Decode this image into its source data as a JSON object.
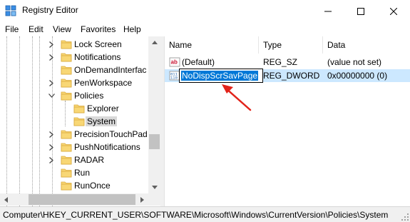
{
  "window": {
    "title": "Registry Editor"
  },
  "menu": [
    "File",
    "Edit",
    "View",
    "Favorites",
    "Help"
  ],
  "tree": {
    "items": [
      {
        "label": "Lock Screen",
        "expander": "collapsed",
        "level": 0
      },
      {
        "label": "Notifications",
        "expander": "collapsed",
        "level": 0
      },
      {
        "label": "OnDemandInterfac",
        "expander": "none",
        "level": 0
      },
      {
        "label": "PenWorkspace",
        "expander": "collapsed",
        "level": 0
      },
      {
        "label": "Policies",
        "expander": "expanded",
        "level": 0
      },
      {
        "label": "Explorer",
        "expander": "none",
        "level": 1
      },
      {
        "label": "System",
        "expander": "none",
        "level": 1,
        "selected": true
      },
      {
        "label": "PrecisionTouchPad",
        "expander": "collapsed",
        "level": 0
      },
      {
        "label": "PushNotifications",
        "expander": "collapsed",
        "level": 0
      },
      {
        "label": "RADAR",
        "expander": "collapsed",
        "level": 0
      },
      {
        "label": "Run",
        "expander": "none",
        "level": 0
      },
      {
        "label": "RunOnce",
        "expander": "none",
        "level": 0
      }
    ]
  },
  "list": {
    "columns": [
      "Name",
      "Type",
      "Data"
    ],
    "rows": [
      {
        "icon": "string-value-icon",
        "name": "(Default)",
        "type": "REG_SZ",
        "data": "(value not set)"
      },
      {
        "icon": "binary-value-icon",
        "name": "NoDispScrSavPage",
        "type": "REG_DWORD",
        "data": "0x00000000 (0)",
        "editing": true,
        "selected": true
      }
    ]
  },
  "status": {
    "path": "Computer\\HKEY_CURRENT_USER\\SOFTWARE\\Microsoft\\Windows\\CurrentVersion\\Policies\\System"
  },
  "colors": {
    "folder": "#f8d775",
    "selection": "#cce8ff",
    "rename_highlight": "#0078d7",
    "annotation_arrow": "#e2231a"
  }
}
